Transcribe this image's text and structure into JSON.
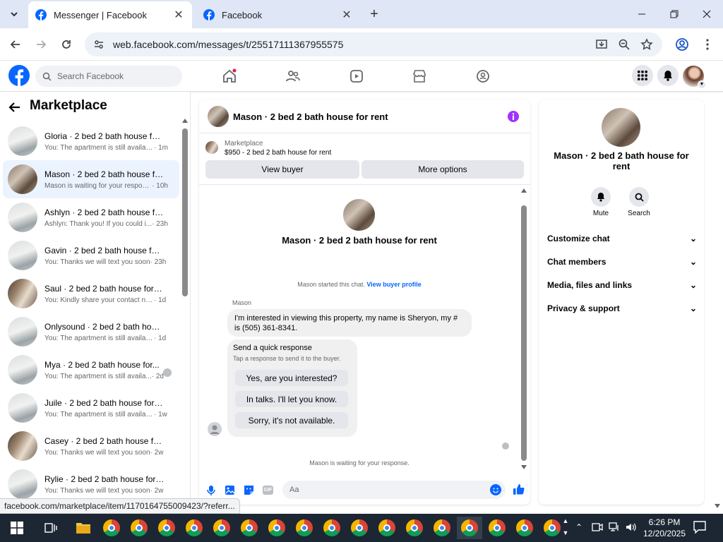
{
  "browser": {
    "tabs": [
      {
        "title": "Messenger | Facebook",
        "active": true
      },
      {
        "title": "Facebook",
        "active": false
      }
    ],
    "url": "web.facebook.com/messages/t/25517111367955575",
    "status_url": "facebook.com/marketplace/item/1170164755009423/?referr..."
  },
  "facebook": {
    "search_placeholder": "Search Facebook",
    "brand_color": "#0866ff"
  },
  "sidebar": {
    "title": "Marketplace",
    "conversations": [
      {
        "name": "Gloria · 2 bed 2 bath house for ...",
        "preview": "You: The apartment is still availabl...",
        "time": "· 1m",
        "selected": false
      },
      {
        "name": "Mason · 2 bed 2 bath house for...",
        "preview": "Mason is waiting for your respon...",
        "time": "· 10h",
        "selected": true
      },
      {
        "name": "Ashlyn · 2 bed 2 bath house for...",
        "preview": "Ashlyn: Thank you! If you could i...",
        "time": "· 23h",
        "selected": false
      },
      {
        "name": "Gavin · 2 bed 2 bath house for r...",
        "preview": "You: Thanks we will text you soon",
        "time": "· 23h",
        "selected": false
      },
      {
        "name": "Saul · 2 bed 2 bath house for rent",
        "preview": "You: Kindly share your contact nu...",
        "time": "· 1d",
        "selected": false
      },
      {
        "name": "Onlysound · 2 bed 2 bath hous...",
        "preview": "You: The apartment is still availabl...",
        "time": "· 1d",
        "selected": false
      },
      {
        "name": "Mya · 2 bed 2 bath house for...",
        "preview": "You: The apartment is still availa...",
        "time": "· 2d",
        "selected": false
      },
      {
        "name": "Juile · 2 bed 2 bath house for re...",
        "preview": "You: The apartment is still availabl...",
        "time": "· 1w",
        "selected": false
      },
      {
        "name": "Casey · 2 bed 2 bath house for r...",
        "preview": "You: Thanks we will text you soon",
        "time": "· 2w",
        "selected": false
      },
      {
        "name": "Rylie · 2 bed 2 bath house for r...",
        "preview": "You: Thanks we will text you soon",
        "time": "· 2w",
        "selected": false
      }
    ]
  },
  "chat": {
    "header_title": "Mason · 2 bed 2 bath house for rent",
    "listing_source": "Marketplace",
    "listing_price_title": "$950 - 2 bed 2 bath house for rent",
    "view_buyer": "View buyer",
    "more_options": "More options",
    "intro_name": "Mason · 2 bed 2 bath house for rent",
    "started_text": "Mason started this chat.",
    "view_buyer_profile": "View buyer profile",
    "sender": "Mason",
    "message": "I'm interested in viewing this property, my name is Sheryon, my # is (505) 361-8341.",
    "quick_title": "Send a quick response",
    "quick_subtitle": "Tap a response to send it to the buyer.",
    "quick_responses": [
      "Yes, are you interested?",
      "In talks. I'll let you know.",
      "Sorry, it's not available."
    ],
    "waiting_text": "Mason is waiting for your response.",
    "composer_placeholder": "Aa"
  },
  "details": {
    "title": "Mason · 2 bed 2 bath house for rent",
    "mute": "Mute",
    "search": "Search",
    "sections": [
      "Customize chat",
      "Chat members",
      "Media, files and links",
      "Privacy & support"
    ]
  },
  "taskbar": {
    "time": "6:26 PM",
    "date": "12/20/2025"
  }
}
